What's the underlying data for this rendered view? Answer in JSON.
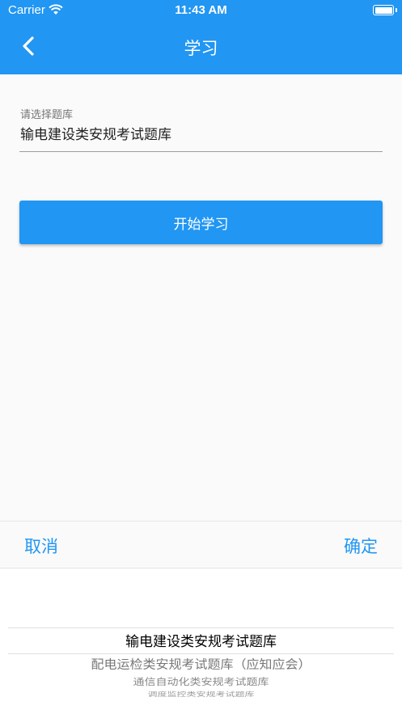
{
  "status_bar": {
    "carrier": "Carrier",
    "time": "11:43 AM"
  },
  "nav": {
    "title": "学习",
    "back_icon": "chevron-left-icon"
  },
  "form": {
    "field_label": "请选择题库",
    "field_value": "输电建设类安规考试题库",
    "start_button": "开始学习"
  },
  "picker": {
    "cancel_label": "取消",
    "confirm_label": "确定",
    "options": [
      "输电建设类安规考试题库",
      "配电运检类安规考试题库（应知应会）",
      "通信自动化类安规考试题库",
      "调度监控类安规考试题库"
    ],
    "selected_index": 0
  },
  "colors": {
    "primary": "#2196f3",
    "background": "#fafafa"
  }
}
